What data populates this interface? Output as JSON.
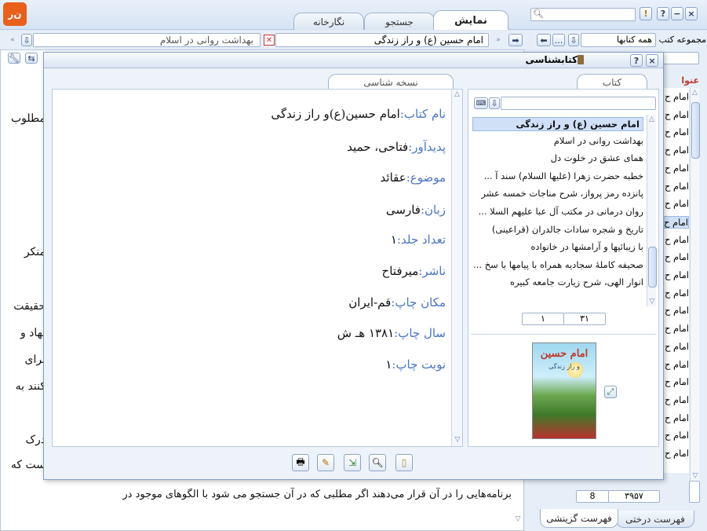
{
  "app": {
    "logo_text": "ن‌ر"
  },
  "top_tabs": [
    {
      "label": "نمایش",
      "active": true
    },
    {
      "label": "جستجو",
      "active": false
    },
    {
      "label": "نگارخانه",
      "active": false
    }
  ],
  "collection": {
    "label": "مجموعه کتب",
    "value": "همه کتابها"
  },
  "toolbar": {
    "book_field": "امام حسین (ع) و راز زندگی",
    "other_field": "بهداشت روانی در اسلام"
  },
  "right_column": {
    "header": "عنوا",
    "item_label": "امام ح",
    "pager": {
      "current": "8",
      "total": "۳۹۵۷"
    },
    "bottom_tabs": [
      {
        "label": "فهرست درختی"
      },
      {
        "label": "فهرست گزینشی"
      }
    ]
  },
  "dialog": {
    "title": "کتابشناسی",
    "left_tab": "نسخه شناسی",
    "right_tab": "کتاب",
    "metadata": [
      {
        "label": "نام کتاب:",
        "value": "امام حسین(ع)و راز زندگی"
      },
      {
        "label": "پدیدآور:",
        "value": "فتاحی، حمید"
      },
      {
        "label": "موضوع:",
        "value": "عقائد"
      },
      {
        "label": "زبان:",
        "value": "فارسی"
      },
      {
        "label": "تعداد جلد:",
        "value": "۱"
      },
      {
        "label": "ناشر:",
        "value": "میرفتاح"
      },
      {
        "label": "مکان چاپ:",
        "value": "قم-ایران"
      },
      {
        "label": "سال چاپ:",
        "value": "۱۳۸۱ هـ ش"
      },
      {
        "label": "نوبت چاپ:",
        "value": "۱"
      }
    ],
    "book_list": [
      "امام حسین (ع) و راز زندگی",
      "بهداشت روانی در اسلام",
      "همای عشق در خلوت دل",
      "خطبه حضرت زهرا (علیها السلام) سند آ ...",
      "پانزده رمز پرواز، شرح مناجات خمسه عشر",
      "روان درمانی در مکتب آل عبا علیهم السلا ...",
      "تاریخ و شجره سادات جالدران (قراعینی)",
      "با زیبائیها و آرامشها در خانواده",
      "صحیفه کاملهٔ سجادیه همراه با پیامها با سخ ...",
      "انوار الهی، شرح زیارت جامعه کبیره"
    ],
    "list_pager": {
      "current": "۱",
      "total": "۳۱"
    },
    "cover": {
      "title": "امام حسین",
      "subtitle": "و راز زندگی"
    }
  },
  "background_text": {
    "fragments": [
      "مطلوب",
      "منکر",
      "حقیقت",
      "نهاد و",
      "برای",
      "کنند به",
      "درک",
      "ست که"
    ],
    "bottom_line": "برنامه‌هایی را در آن قرار می‌دهند اگر مطلبی که در آن جستجو می شود با الگوهای موجود در"
  },
  "colors": {
    "accent": "#4a74c6",
    "window_bg": "#dfeaf6",
    "logo": "#e8601c"
  }
}
